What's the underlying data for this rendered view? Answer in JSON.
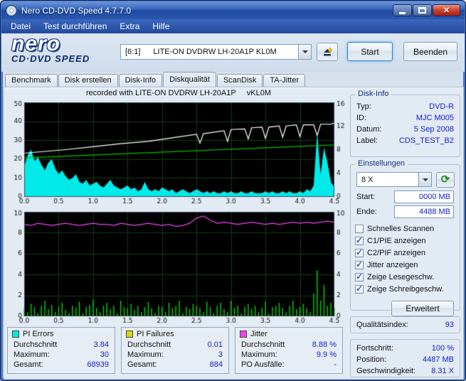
{
  "window": {
    "title": "Nero CD-DVD Speed 4.7.7.0"
  },
  "menu": {
    "items": [
      "Datei",
      "Test durchführen",
      "Extra",
      "Hilfe"
    ]
  },
  "logo": {
    "name": "nero",
    "sub": "CD·DVD SPEED"
  },
  "toolbar": {
    "drive_bus": "[6:1]",
    "drive_name": "LITE-ON DVDRW LH-20A1P KL0M",
    "start": "Start",
    "quit": "Beenden"
  },
  "icons": {
    "refresh": "⟳"
  },
  "tabs": {
    "items": [
      "Benchmark",
      "Disk erstellen",
      "Disk-Info",
      "Diskqualität",
      "ScanDisk",
      "TA-Jitter"
    ],
    "active": "Diskqualität"
  },
  "chart_data": [
    {
      "type": "area",
      "title": "recorded with LITE-ON DVDRW LH-20A1P     vKL0M",
      "xlim": [
        0,
        4.5
      ],
      "x_ticks": [
        0,
        0.5,
        1,
        1.5,
        2,
        2.5,
        3,
        3.5,
        4,
        4.5
      ],
      "ylim_left": [
        0,
        50
      ],
      "y_ticks_left": [
        0,
        10,
        20,
        30,
        40,
        50
      ],
      "ylim_right": [
        0,
        16
      ],
      "y_ticks_right": [
        0,
        4,
        8,
        12,
        16
      ],
      "grid_color": "#123c12",
      "series": [
        {
          "name": "PI Errors",
          "type": "area",
          "axis": "left",
          "color": "#00eaea",
          "y": [
            16,
            22,
            25,
            19,
            21,
            17,
            14,
            18,
            20,
            15,
            12,
            14,
            11,
            9,
            10,
            12,
            8,
            7,
            9,
            6,
            7,
            8,
            6,
            5,
            7,
            9,
            6,
            5,
            4,
            5,
            6,
            4,
            5,
            3,
            4,
            8,
            4,
            3,
            4,
            3,
            5,
            4,
            3,
            4,
            2,
            3,
            4,
            3,
            2,
            3,
            4,
            3,
            2,
            3,
            2,
            3,
            2,
            2,
            3,
            2,
            3,
            2,
            2,
            3,
            2,
            2,
            3,
            2,
            2,
            2,
            3,
            2,
            3,
            2,
            2,
            3,
            2,
            3,
            2,
            2,
            3,
            2,
            4,
            3,
            6,
            34,
            12,
            26,
            18,
            8,
            5
          ]
        },
        {
          "name": "Scan-Geschwindigkeit",
          "type": "line",
          "axis": "right",
          "color": "#00c000",
          "x": [
            0,
            4.5
          ],
          "y": [
            6.6,
            8.8
          ]
        },
        {
          "name": "Schreibgeschwindigkeit",
          "type": "line",
          "axis": "right",
          "color": "#ffffff",
          "x": [
            0,
            0.3,
            0.6,
            1.0,
            1.4,
            1.8,
            2.2,
            2.5,
            2.55,
            2.6,
            2.9,
            2.95,
            3.0,
            3.2,
            3.25,
            3.3,
            3.45,
            3.5,
            3.55,
            3.7,
            3.75,
            3.8,
            3.95,
            4.0,
            4.05,
            4.2,
            4.25,
            4.3,
            4.45,
            4.5
          ],
          "y": [
            7.4,
            7.7,
            8.0,
            8.5,
            9.0,
            9.4,
            10.1,
            10.6,
            9.1,
            10.7,
            11.2,
            9.4,
            11.4,
            11.5,
            9.8,
            11.7,
            11.8,
            9.9,
            11.8,
            12.0,
            10.1,
            12.0,
            12.2,
            10.2,
            12.2,
            12.2,
            10.4,
            12.3,
            12.3,
            12.5
          ]
        }
      ]
    },
    {
      "type": "line",
      "xlim": [
        0,
        4.5
      ],
      "x_ticks": [
        0,
        0.5,
        1,
        1.5,
        2,
        2.5,
        3,
        3.5,
        4,
        4.5
      ],
      "ylim_left": [
        0,
        10
      ],
      "y_ticks_left": [
        0,
        2,
        4,
        6,
        8,
        10
      ],
      "ylim_right": [
        0,
        10
      ],
      "y_ticks_right": [
        0,
        2,
        4,
        6,
        8,
        10
      ],
      "grid_color": "#123c12",
      "series": [
        {
          "name": "PI Failures",
          "type": "bars",
          "axis": "left",
          "color": "#00d800",
          "y": [
            0.8,
            0.4,
            1.2,
            0.9,
            0.3,
            1.0,
            1.5,
            0.7,
            1.1,
            0.4,
            0.9,
            1.3,
            0.6,
            0.3,
            1.0,
            0.8,
            1.4,
            0.3,
            0.9,
            1.1,
            1.6,
            0.8,
            0.4,
            1.0,
            1.3,
            0.7,
            1.0,
            0.3,
            1.5,
            0.9,
            0.8,
            1.2,
            0.6,
            1.0,
            0.4,
            0.9,
            1.4,
            0.8,
            0.3,
            1.0,
            0.9,
            0.4,
            1.3,
            0.8,
            1.0,
            1.5,
            0.3,
            0.9,
            0.7,
            1.2,
            1.0,
            0.8,
            0.4,
            1.4,
            0.9,
            0.3,
            1.0,
            1.3,
            0.7,
            0.4,
            1.5,
            0.8,
            1.0,
            0.3,
            0.9,
            1.2,
            0.7,
            1.0,
            0.4,
            0.8,
            1.4,
            0.3,
            0.9,
            1.0,
            1.3,
            0.8,
            0.4,
            1.0,
            1.5,
            0.7,
            0.9,
            1.2,
            0.8,
            0.4,
            2.2,
            4.4,
            1.5,
            3.0,
            1.0,
            1.3,
            0.8
          ]
        },
        {
          "name": "Jitter",
          "type": "line",
          "axis": "right",
          "color": "#ee44ee",
          "y": [
            8.8,
            8.7,
            8.9,
            8.8,
            8.7,
            8.8,
            8.9,
            8.8,
            8.7,
            8.8,
            8.9,
            8.8,
            8.8,
            8.7,
            8.9,
            8.8,
            8.7,
            8.8,
            8.9,
            8.8,
            8.7,
            8.8,
            8.6,
            8.7,
            8.9,
            9.4,
            9.6,
            9.2,
            8.9,
            9.0,
            8.9,
            8.8,
            8.9,
            9.0,
            8.9,
            8.8,
            8.9,
            8.8,
            8.9,
            9.0,
            8.9,
            9.0,
            8.9,
            9.0,
            9.1,
            9.0
          ]
        }
      ]
    }
  ],
  "disk_info": {
    "title": "Disk-Info",
    "rows": [
      {
        "label": "Typ:",
        "value": "DVD-R"
      },
      {
        "label": "ID:",
        "value": "MJC M005"
      },
      {
        "label": "Datum:",
        "value": "5 Sep 2008"
      },
      {
        "label": "Label:",
        "value": "CDS_TEST_B2"
      }
    ]
  },
  "settings": {
    "title": "Einstellungen",
    "speed": "8 X",
    "start_label": "Start:",
    "start_value": "0000 MB",
    "end_label": "Ende:",
    "end_value": "4488 MB",
    "checkboxes": [
      {
        "label": "Schnelles Scannen",
        "checked": false
      },
      {
        "label": "C1/PIE anzeigen",
        "checked": true
      },
      {
        "label": "C2/PIF anzeigen",
        "checked": true
      },
      {
        "label": "Jitter anzeigen",
        "checked": true
      },
      {
        "label": "Zeige Lesegeschw.",
        "checked": true
      },
      {
        "label": "Zeige Schreibgeschw.",
        "checked": true
      }
    ],
    "advanced": "Erweitert"
  },
  "quality": {
    "label": "Qualitätsindex:",
    "value": "93"
  },
  "progress": {
    "rows": [
      {
        "label": "Fortschritt:",
        "value": "100 %"
      },
      {
        "label": "Position:",
        "value": "4487 MB"
      },
      {
        "label": "Geschwindigkeit:",
        "value": "8.31 X"
      }
    ]
  },
  "stats": [
    {
      "title": "PI Errors",
      "color": "#00eaea",
      "rows": [
        {
          "label": "Durchschnitt",
          "value": "3.84"
        },
        {
          "label": "Maximum:",
          "value": "30"
        },
        {
          "label": "Gesamt:",
          "value": "68939"
        }
      ]
    },
    {
      "title": "PI Failures",
      "color": "#d8d800",
      "rows": [
        {
          "label": "Durchschnitt",
          "value": "0.01"
        },
        {
          "label": "Maximum:",
          "value": "3"
        },
        {
          "label": "Gesamt:",
          "value": "884"
        }
      ]
    },
    {
      "title": "Jitter",
      "color": "#ee44ee",
      "rows": [
        {
          "label": "Durchschnitt",
          "value": "8.88 %"
        },
        {
          "label": "Maximum:",
          "value": "9.9 %"
        },
        {
          "label": "PO Ausfälle:",
          "value": "-"
        }
      ]
    }
  ]
}
